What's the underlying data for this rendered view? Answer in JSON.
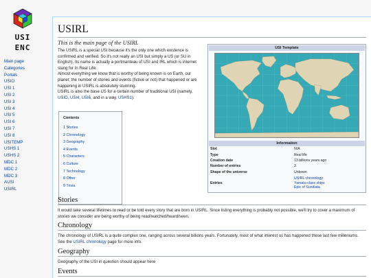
{
  "logo": {
    "line1": "USI",
    "line2": "ENC"
  },
  "nav": [
    "Main page",
    "Categories",
    "Portals",
    "USIO",
    "USI 1",
    "USI 2",
    "USI 3",
    "USI 4",
    "USI 5",
    "USI 6",
    "USI 7",
    "USI 8",
    "USITEMP",
    "USHS 1",
    "USHS 2",
    "MDC 1",
    "MDC 2",
    "MDC 3",
    "AUSI",
    "USIRL"
  ],
  "page": {
    "title": "USIRL",
    "subtitle": "This is the main page of the USIRL",
    "intro": {
      "p1": "The USIRL is a special USI because it's the only one which existence is confirmed and verified. So it's not really an USI but simply a US (or SU in English). Its name is actually a portmanteau of USI and IRL which is internet slang for In Real Life.",
      "p2": "Almost everything we know that is worthy of being known is on Earth, our planet; the number of stories and events (fictive or not) that happened or are happening in USIRL is absolutely stunning.",
      "p3_pre": "USIRL is also the base US for a certain number of traditional USI (namely, ",
      "link_usio": "USIO",
      "sep1": ", ",
      "link_usi4": "USI4",
      "sep2": ", ",
      "link_usi6": "USI6",
      "p3_mid": ", and in a way, ",
      "link_ushs1": "USHS1",
      "p3_end": ")."
    }
  },
  "infobox": {
    "header": "USI Template",
    "info_header": "Information",
    "rows": [
      {
        "key": "Slot",
        "value": "N/A"
      },
      {
        "key": "Type",
        "value": "Real life"
      },
      {
        "key": "Creation date",
        "value": "13 billions years ago"
      },
      {
        "key": "Number of entries",
        "value": "2"
      },
      {
        "key": "Shape of the universe",
        "value": "Unkown"
      }
    ],
    "entries_key": "Entries",
    "entries": [
      "USIRL chronology",
      "Yamato-class ships",
      "Epic of Sundiata"
    ]
  },
  "toc": {
    "title": "Contents",
    "items": [
      "1 Stories",
      "2 Chronology",
      "3 Geography",
      "4 Events",
      "5 Characters",
      "6 Culture",
      "7 Technology",
      "8 Other",
      "9 Trivia"
    ]
  },
  "sections": {
    "stories": {
      "heading": "Stories",
      "text": "It would take several lifetimes to read or be told every story that are born in USIRL. Since listing everything is probably not possible, we'll try to cover a maximum of stories we consider are being worthy of being read/watched/heard/seen."
    },
    "chronology": {
      "heading": "Chronology",
      "text_pre": "The chronology of USIRL is a quite complex one, ranging across several billions years. Fortunately, most of what interest us has happened these last few milleniums. See the ",
      "link": "USIRL chronology",
      "text_post": " page for more info."
    },
    "geography": {
      "heading": "Geography",
      "text": "Geography of the USI in question should appear here"
    },
    "events": {
      "heading": "Events"
    }
  },
  "colors": {
    "link": "#0645ad",
    "ocean": "#35a9b5",
    "land": "#dfd5b4",
    "infobox_header": "#cad4e6"
  }
}
